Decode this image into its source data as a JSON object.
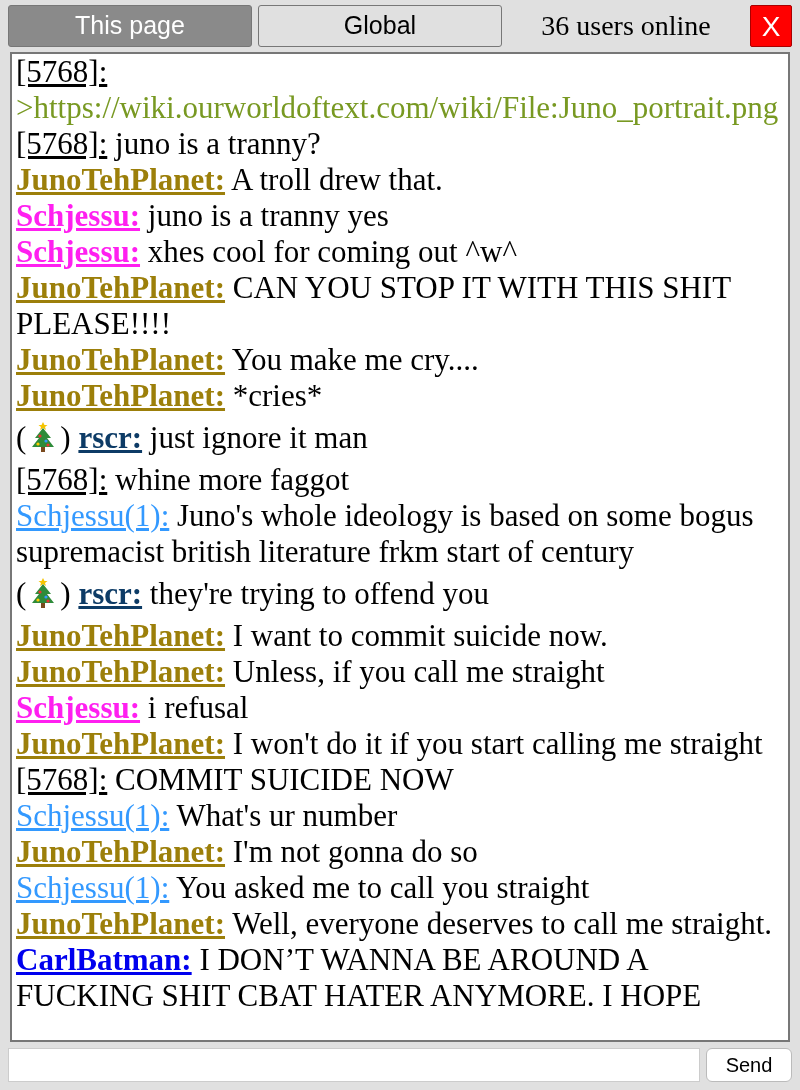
{
  "tabs": [
    {
      "label": "This page",
      "selected": true
    },
    {
      "label": "Global",
      "selected": false
    }
  ],
  "online_count": "36 users online",
  "close_button": "X",
  "messages": [
    {
      "kind": "anon",
      "user": "[5768]:",
      "text": ">https://wiki.ourworldoftext.com/wiki/File:Juno_portrait.png",
      "quote": true
    },
    {
      "kind": "anon",
      "user": "[5768]:",
      "text": "juno is a tranny?",
      "quote": false
    },
    {
      "kind": "registered",
      "user": "JunoTehPlanet:",
      "color": "#9c7f0a",
      "text": "A troll drew that.",
      "quote": false
    },
    {
      "kind": "registered",
      "user": "Schjessu:",
      "color": "#ff1ff0",
      "text": "juno is a tranny yes",
      "quote": false
    },
    {
      "kind": "registered",
      "user": "Schjessu:",
      "color": "#ff1ff0",
      "text": "xhes cool for coming out ^w^",
      "quote": false
    },
    {
      "kind": "registered",
      "user": "JunoTehPlanet:",
      "color": "#9c7f0a",
      "text": "CAN YOU STOP IT WITH THIS SHIT PLEASE!!!!",
      "quote": false
    },
    {
      "kind": "registered",
      "user": "JunoTehPlanet:",
      "color": "#9c7f0a",
      "text": "You make me cry....",
      "quote": false
    },
    {
      "kind": "registered",
      "user": "JunoTehPlanet:",
      "color": "#9c7f0a",
      "text": "*cries*",
      "quote": false
    },
    {
      "kind": "registered",
      "user": "rscr:",
      "color": "#0d3b66",
      "badge": [
        "(",
        ")"
      ],
      "text": "just ignore it man",
      "quote": false
    },
    {
      "kind": "anon",
      "user": "[5768]:",
      "text": "whine more faggot",
      "quote": false
    },
    {
      "kind": "nick",
      "user": "Schjessu(1):",
      "color": "#3399ff",
      "text": "Juno's whole ideology is based on some bogus supremacist british literature frkm start of century",
      "quote": false
    },
    {
      "kind": "registered",
      "user": "rscr:",
      "color": "#0d3b66",
      "badge": [
        "(",
        ")"
      ],
      "text": "they're trying to offend you",
      "quote": false
    },
    {
      "kind": "registered",
      "user": "JunoTehPlanet:",
      "color": "#9c7f0a",
      "text": "I want to commit suicide now.",
      "quote": false
    },
    {
      "kind": "registered",
      "user": "JunoTehPlanet:",
      "color": "#9c7f0a",
      "text": "Unless, if you call me straight",
      "quote": false
    },
    {
      "kind": "registered",
      "user": "Schjessu:",
      "color": "#ff1ff0",
      "text": "i refusal",
      "quote": false
    },
    {
      "kind": "registered",
      "user": "JunoTehPlanet:",
      "color": "#9c7f0a",
      "text": "I won't do it if you start calling me straight",
      "quote": false
    },
    {
      "kind": "anon",
      "user": "[5768]:",
      "text": "COMMIT SUICIDE NOW",
      "quote": false
    },
    {
      "kind": "nick",
      "user": "Schjessu(1):",
      "color": "#3399ff",
      "text": "What's ur number",
      "quote": false
    },
    {
      "kind": "registered",
      "user": "JunoTehPlanet:",
      "color": "#9c7f0a",
      "text": "I'm not gonna do so",
      "quote": false
    },
    {
      "kind": "nick",
      "user": "Schjessu(1):",
      "color": "#3399ff",
      "text": "You asked me to call you straight",
      "quote": false
    },
    {
      "kind": "registered",
      "user": "JunoTehPlanet:",
      "color": "#9c7f0a",
      "text": "Well, everyone deserves to call me straight.",
      "quote": false
    },
    {
      "kind": "registered",
      "user": "CarlBatman:",
      "color": "#0000ee",
      "text": "I DON’T WANNA BE AROUND A FUCKING SHIT CBAT HATER ANYMORE. I HOPE",
      "quote": false
    }
  ],
  "send_button": "Send"
}
